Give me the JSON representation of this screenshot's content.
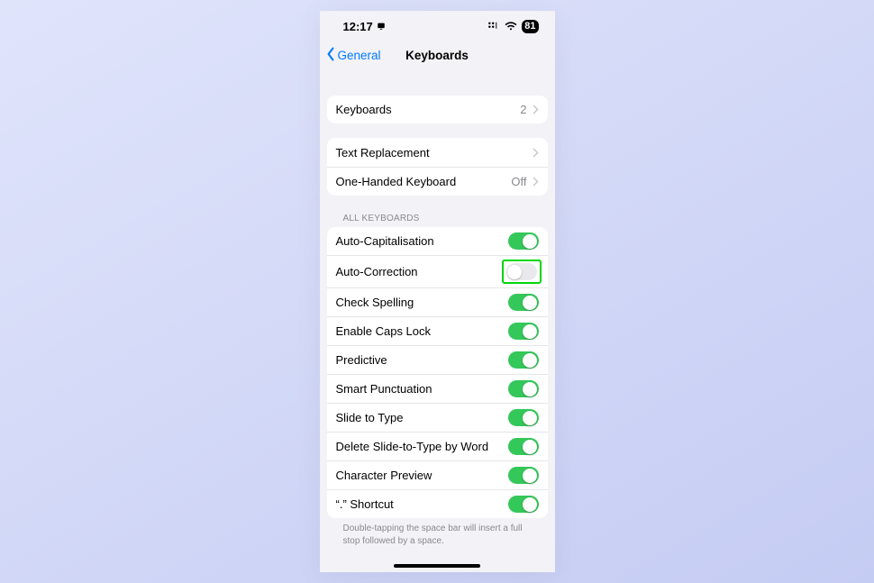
{
  "status": {
    "time": "12:17",
    "screen_share_icon": "screen-indicator-icon",
    "battery": "81"
  },
  "nav": {
    "back_label": "General",
    "title": "Keyboards"
  },
  "group1": {
    "keyboards_label": "Keyboards",
    "keyboards_count": "2"
  },
  "group2": {
    "text_replacement_label": "Text Replacement",
    "one_handed_label": "One-Handed Keyboard",
    "one_handed_value": "Off"
  },
  "section_header": "ALL KEYBOARDS",
  "toggles": {
    "auto_cap": {
      "label": "Auto-Capitalisation",
      "on": true
    },
    "auto_correct": {
      "label": "Auto-Correction",
      "on": false,
      "highlight": true
    },
    "spelling": {
      "label": "Check Spelling",
      "on": true
    },
    "caps_lock": {
      "label": "Enable Caps Lock",
      "on": true
    },
    "predictive": {
      "label": "Predictive",
      "on": true
    },
    "smart_punc": {
      "label": "Smart Punctuation",
      "on": true
    },
    "slide": {
      "label": "Slide to Type",
      "on": true
    },
    "delete_slide": {
      "label": "Delete Slide-to-Type by Word",
      "on": true
    },
    "char_preview": {
      "label": "Character Preview",
      "on": true
    },
    "shortcut": {
      "label": "“.” Shortcut",
      "on": true
    }
  },
  "footer_text": "Double-tapping the space bar will insert a full stop followed by a space."
}
